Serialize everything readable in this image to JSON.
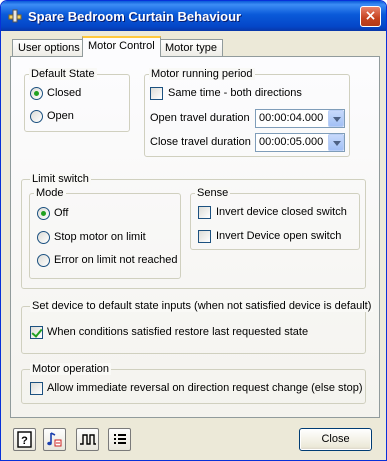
{
  "window": {
    "title": "Spare Bedroom Curtain Behaviour",
    "close_glyph": "×"
  },
  "tabs": [
    {
      "label": "User options",
      "active": false
    },
    {
      "label": "Motor Control",
      "active": true
    },
    {
      "label": "Motor type",
      "active": false
    }
  ],
  "default_state": {
    "legend": "Default State",
    "options": [
      {
        "label": "Closed",
        "selected": true
      },
      {
        "label": "Open",
        "selected": false
      }
    ]
  },
  "motor_running_period": {
    "legend": "Motor running period",
    "same_time_label": "Same time - both directions",
    "same_time_checked": false,
    "open_label": "Open travel duration",
    "open_value": "00:00:04.000",
    "close_label": "Close travel duration",
    "close_value": "00:00:05.000"
  },
  "limit_switch": {
    "legend": "Limit switch",
    "mode": {
      "legend": "Mode",
      "options": [
        {
          "label": "Off",
          "selected": true
        },
        {
          "label": "Stop motor on limit",
          "selected": false
        },
        {
          "label": "Error on limit not reached",
          "selected": false
        }
      ]
    },
    "sense": {
      "legend": "Sense",
      "invert_closed_label": "Invert device closed switch",
      "invert_closed_checked": false,
      "invert_open_label": "Invert Device open switch",
      "invert_open_checked": false
    }
  },
  "default_inputs": {
    "legend": "Set device to default state inputs (when not satisfied device is default)",
    "restore_label": "When conditions satisfied restore last requested state",
    "restore_checked": true
  },
  "motor_operation": {
    "legend": "Motor operation",
    "reversal_label": "Allow immediate reversal on direction request change (else stop)",
    "reversal_checked": false
  },
  "footer": {
    "icons": [
      "help-icon",
      "music-note-icon",
      "pulse-wave-icon",
      "list-icon"
    ],
    "close_label": "Close"
  },
  "colors": {
    "titlebar": "#0a5ad9",
    "window_bg": "#ece9d8",
    "check_green": "#21a121",
    "tab_highlight": "#ffc83c"
  }
}
